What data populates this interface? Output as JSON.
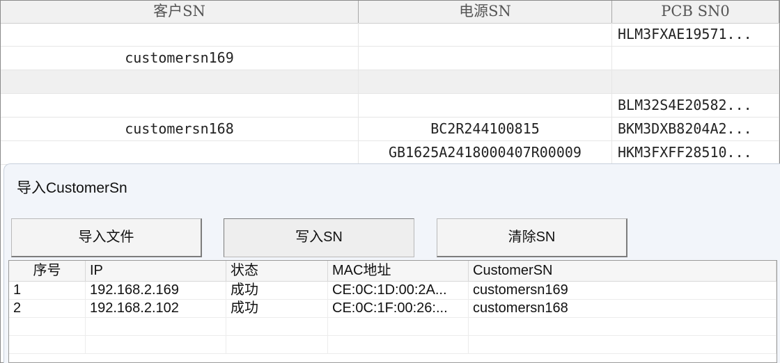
{
  "background_table": {
    "columns": [
      "客户SN",
      "电源SN",
      "PCB SN0"
    ],
    "rows": [
      {
        "customer_sn": "",
        "power_sn": "",
        "pcb_sn0": "HLM3FXAE19571...",
        "shade": false
      },
      {
        "customer_sn": "customersn169",
        "power_sn": "",
        "pcb_sn0": "",
        "shade": false
      },
      {
        "customer_sn": "",
        "power_sn": "",
        "pcb_sn0": "",
        "shade": true
      },
      {
        "customer_sn": "",
        "power_sn": "",
        "pcb_sn0": "BLM32S4E20582...",
        "shade": false
      },
      {
        "customer_sn": "customersn168",
        "power_sn": "BC2R244100815",
        "pcb_sn0": "BKM3DXB8204A2...",
        "shade": false
      },
      {
        "customer_sn": "",
        "power_sn": "GB1625A2418000407R00009",
        "pcb_sn0": "HKM3FXFF28510...",
        "shade": false
      }
    ]
  },
  "dialog": {
    "title": "导入CustomerSn",
    "buttons": {
      "import_file": "导入文件",
      "write_sn": "写入SN",
      "clear_sn": "清除SN"
    },
    "list": {
      "columns": [
        "序号",
        "IP",
        "状态",
        "MAC地址",
        "CustomerSN"
      ],
      "rows": [
        {
          "index": "1",
          "ip": "192.168.2.169",
          "status": "成功",
          "mac": "CE:0C:1D:00:2A...",
          "customer_sn": "customersn169"
        },
        {
          "index": "2",
          "ip": "192.168.2.102",
          "status": "成功",
          "mac": "CE:0C:1F:00:26:...",
          "customer_sn": "customersn168"
        },
        {
          "index": "",
          "ip": "",
          "status": "",
          "mac": "",
          "customer_sn": ""
        },
        {
          "index": "",
          "ip": "",
          "status": "",
          "mac": "",
          "customer_sn": ""
        }
      ]
    }
  }
}
